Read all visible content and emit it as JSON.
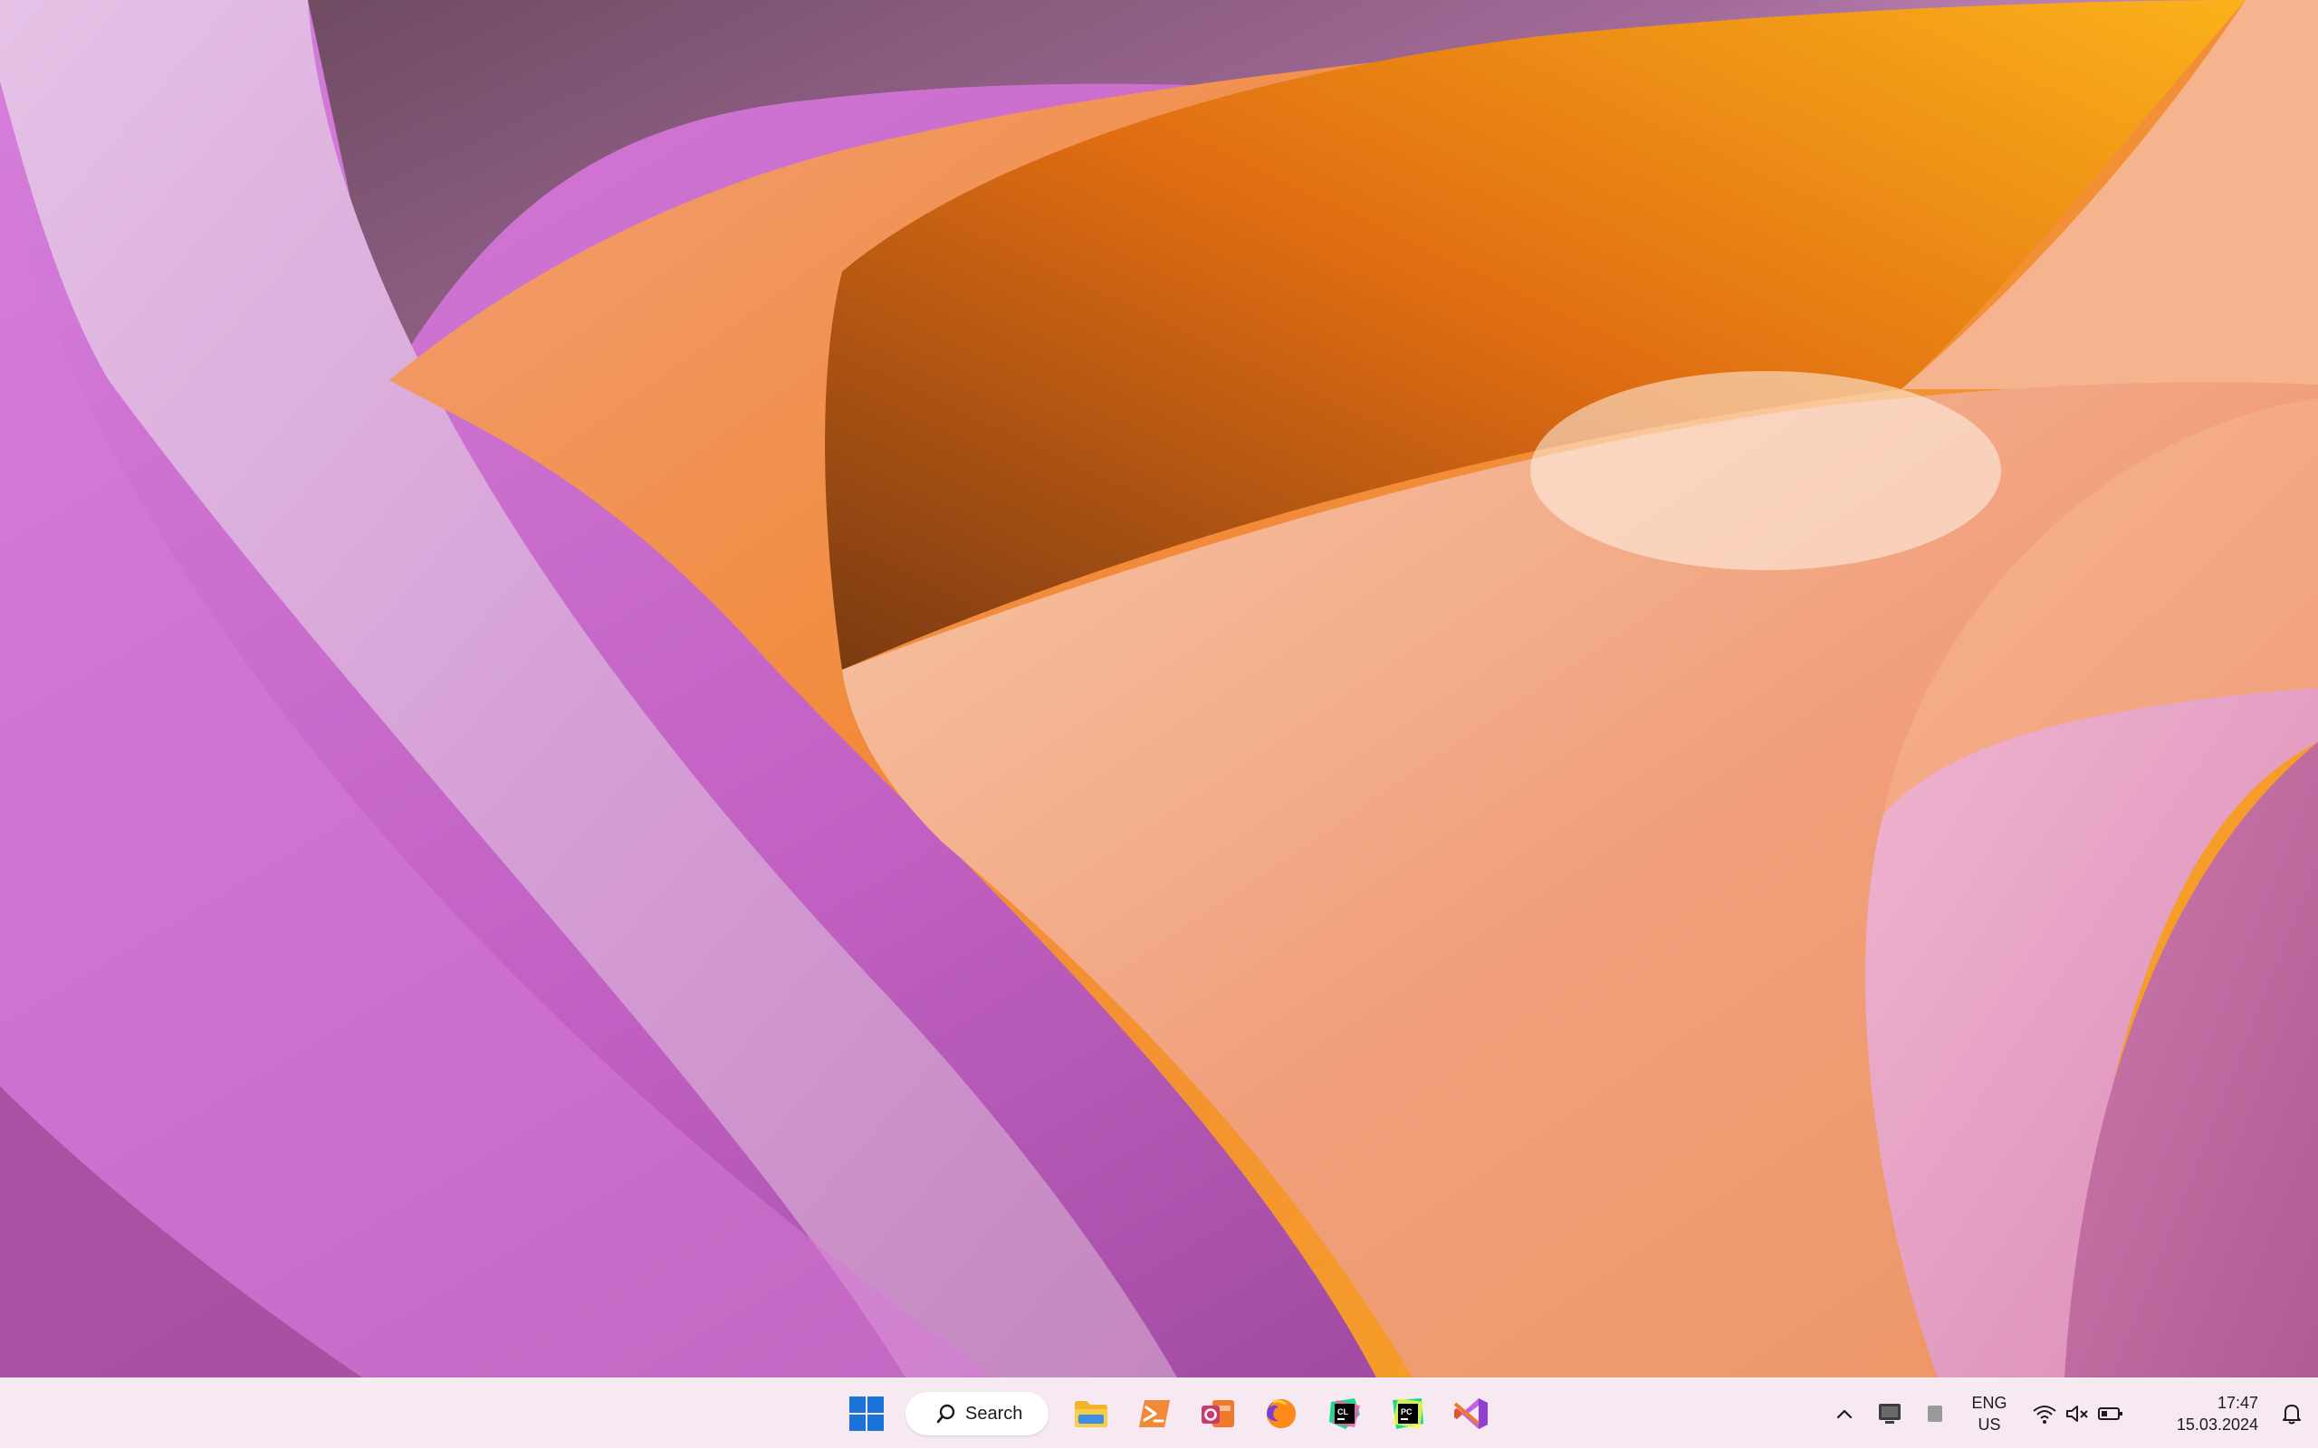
{
  "wallpaper": {
    "name": "abstract-petals",
    "colors": {
      "magenta": "#c05fbf",
      "lilac": "#d6a6d3",
      "plum": "#7a4d67",
      "orange": "#f39a3c",
      "amber": "#f7a81b",
      "peach": "#f2a580",
      "pink": "#e7a0c4"
    }
  },
  "taskbar": {
    "search": {
      "label": "Search"
    },
    "pinned": [
      {
        "name": "File Explorer",
        "icon": "folder-icon"
      },
      {
        "name": "PowerShell",
        "icon": "terminal-icon"
      },
      {
        "name": "Outlook",
        "icon": "outlook-icon"
      },
      {
        "name": "Firefox",
        "icon": "firefox-icon"
      },
      {
        "name": "CLion",
        "icon": "clion-icon"
      },
      {
        "name": "PyCharm",
        "icon": "pycharm-icon"
      },
      {
        "name": "Visual Studio",
        "icon": "visual-studio-icon"
      }
    ],
    "tray": {
      "lang_line1": "ENG",
      "lang_line2": "US",
      "time": "17:47",
      "date": "15.03.2024"
    }
  }
}
